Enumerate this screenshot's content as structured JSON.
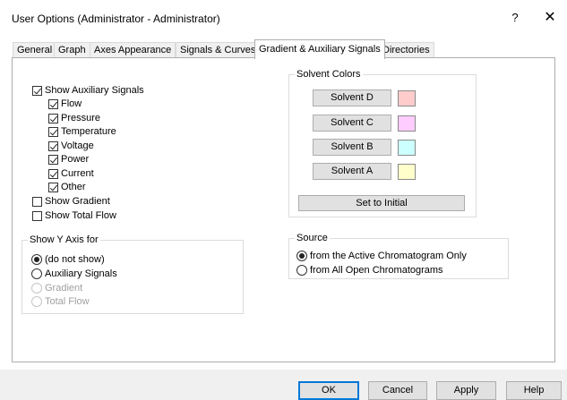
{
  "window": {
    "title": "User Options (Administrator - Administrator)",
    "help_glyph": "?",
    "close_glyph": "✕"
  },
  "tabs": [
    {
      "label": "General"
    },
    {
      "label": "Graph"
    },
    {
      "label": "Axes Appearance"
    },
    {
      "label": "Signals & Curves"
    },
    {
      "label": "Gradient & Auxiliary Signals",
      "active": true
    },
    {
      "label": "Directories"
    }
  ],
  "aux_signals": {
    "show_label": "Show Auxiliary Signals",
    "show_checked": true,
    "items": [
      {
        "label": "Flow",
        "checked": true
      },
      {
        "label": "Pressure",
        "checked": true
      },
      {
        "label": "Temperature",
        "checked": true
      },
      {
        "label": "Voltage",
        "checked": true
      },
      {
        "label": "Power",
        "checked": true
      },
      {
        "label": "Current",
        "checked": true
      },
      {
        "label": "Other",
        "checked": true
      }
    ],
    "show_gradient_label": "Show Gradient",
    "show_gradient_checked": false,
    "show_total_flow_label": "Show Total Flow",
    "show_total_flow_checked": false
  },
  "y_axis": {
    "group_label": "Show Y Axis for",
    "options": [
      {
        "label": "(do not show)",
        "selected": true,
        "disabled": false
      },
      {
        "label": "Auxiliary Signals",
        "selected": false,
        "disabled": false
      },
      {
        "label": "Gradient",
        "selected": false,
        "disabled": true
      },
      {
        "label": "Total Flow",
        "selected": false,
        "disabled": true
      }
    ]
  },
  "solvent_colors": {
    "group_label": "Solvent Colors",
    "solvents": [
      {
        "label": "Solvent D",
        "color": "#ffcccc"
      },
      {
        "label": "Solvent C",
        "color": "#ffccff"
      },
      {
        "label": "Solvent B",
        "color": "#ccffff"
      },
      {
        "label": "Solvent A",
        "color": "#ffffcc"
      }
    ],
    "reset_label": "Set to Initial"
  },
  "source": {
    "group_label": "Source",
    "options": [
      {
        "label": "from the Active Chromatogram Only",
        "selected": true
      },
      {
        "label": "from All Open Chromatograms",
        "selected": false
      }
    ]
  },
  "footer": {
    "ok_label": "OK",
    "cancel_label": "Cancel",
    "apply_label": "Apply",
    "help_label": "Help"
  }
}
